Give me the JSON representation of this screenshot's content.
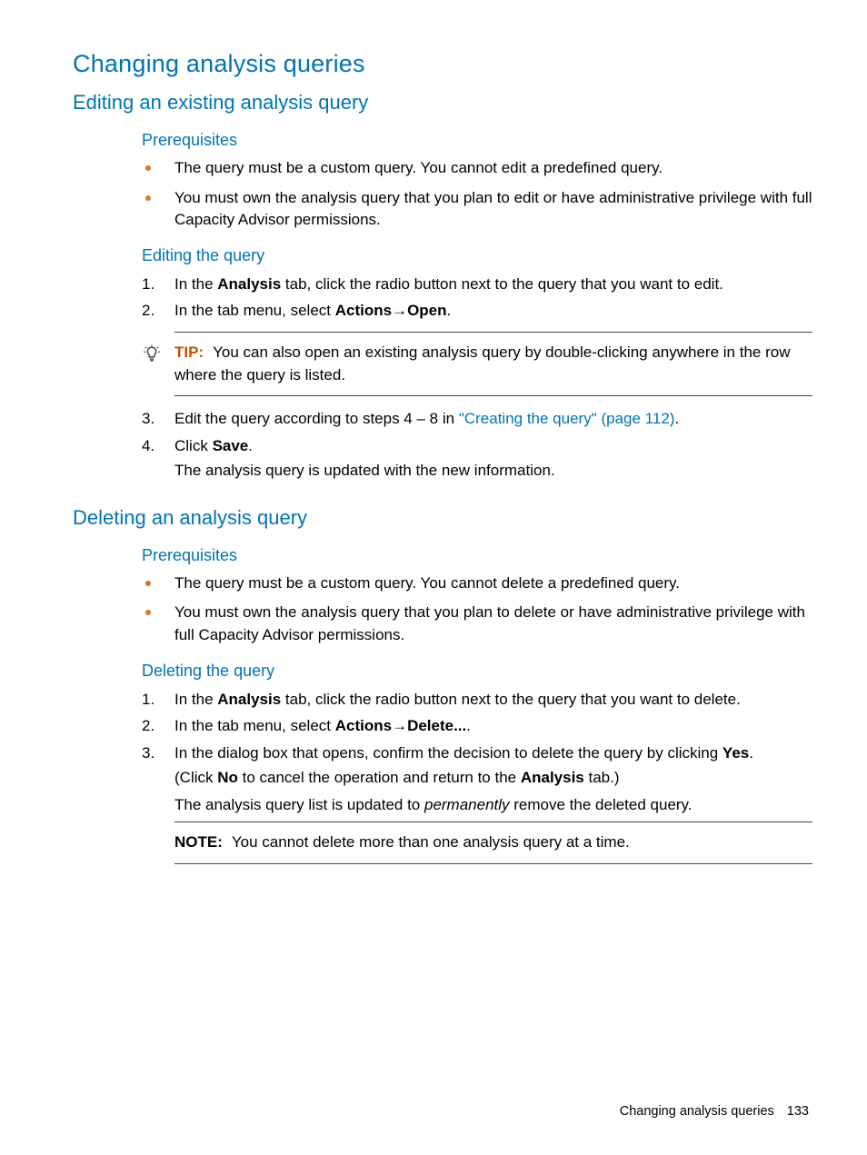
{
  "h1": "Changing analysis queries",
  "editing": {
    "h2": "Editing an existing analysis query",
    "prereq_h": "Prerequisites",
    "prereq_items": [
      "The query must be a custom query. You cannot edit a predefined query.",
      "You must own the analysis query that you plan to edit or have administrative privilege with full Capacity Advisor permissions."
    ],
    "steps_h": "Editing the query",
    "step1_a": "In the ",
    "step1_b": "Analysis",
    "step1_c": " tab, click the radio button next to the query that you want to edit.",
    "step2_a": "In the tab menu, select ",
    "step2_b": "Actions",
    "step2_arrow": "→",
    "step2_c": "Open",
    "step2_d": ".",
    "tip_label": "TIP:",
    "tip_text": "You can also open an existing analysis query by double-clicking anywhere in the row where the query is listed.",
    "step3_a": "Edit the query according to steps 4 – 8 in ",
    "step3_link": "\"Creating the query\" (page 112)",
    "step3_b": ".",
    "step4_a": "Click ",
    "step4_b": "Save",
    "step4_c": ".",
    "step4_after": "The analysis query is updated with the new information."
  },
  "deleting": {
    "h2": "Deleting an analysis query",
    "prereq_h": "Prerequisites",
    "prereq_items": [
      "The query must be a custom query. You cannot delete a predefined query.",
      "You must own the analysis query that you plan to delete or have administrative privilege with full Capacity Advisor permissions."
    ],
    "steps_h": "Deleting the query",
    "step1_a": "In the ",
    "step1_b": "Analysis",
    "step1_c": " tab, click the radio button next to the query that you want to delete.",
    "step2_a": "In the tab menu, select ",
    "step2_b": "Actions",
    "step2_arrow": "→",
    "step2_c": "Delete...",
    "step2_d": ".",
    "step3_a": "In the dialog box that opens, confirm the decision to delete the query by clicking ",
    "step3_b": "Yes",
    "step3_c": ".",
    "step3_after1_a": "(Click ",
    "step3_after1_b": "No",
    "step3_after1_c": " to cancel the operation and return to the ",
    "step3_after1_d": "Analysis",
    "step3_after1_e": " tab.)",
    "step3_after2_a": "The analysis query list is updated to ",
    "step3_after2_b": "permanently",
    "step3_after2_c": " remove the deleted query.",
    "note_label": "NOTE:",
    "note_text": "You cannot delete more than one analysis query at a time."
  },
  "footer": {
    "text": "Changing analysis queries",
    "page": "133"
  }
}
